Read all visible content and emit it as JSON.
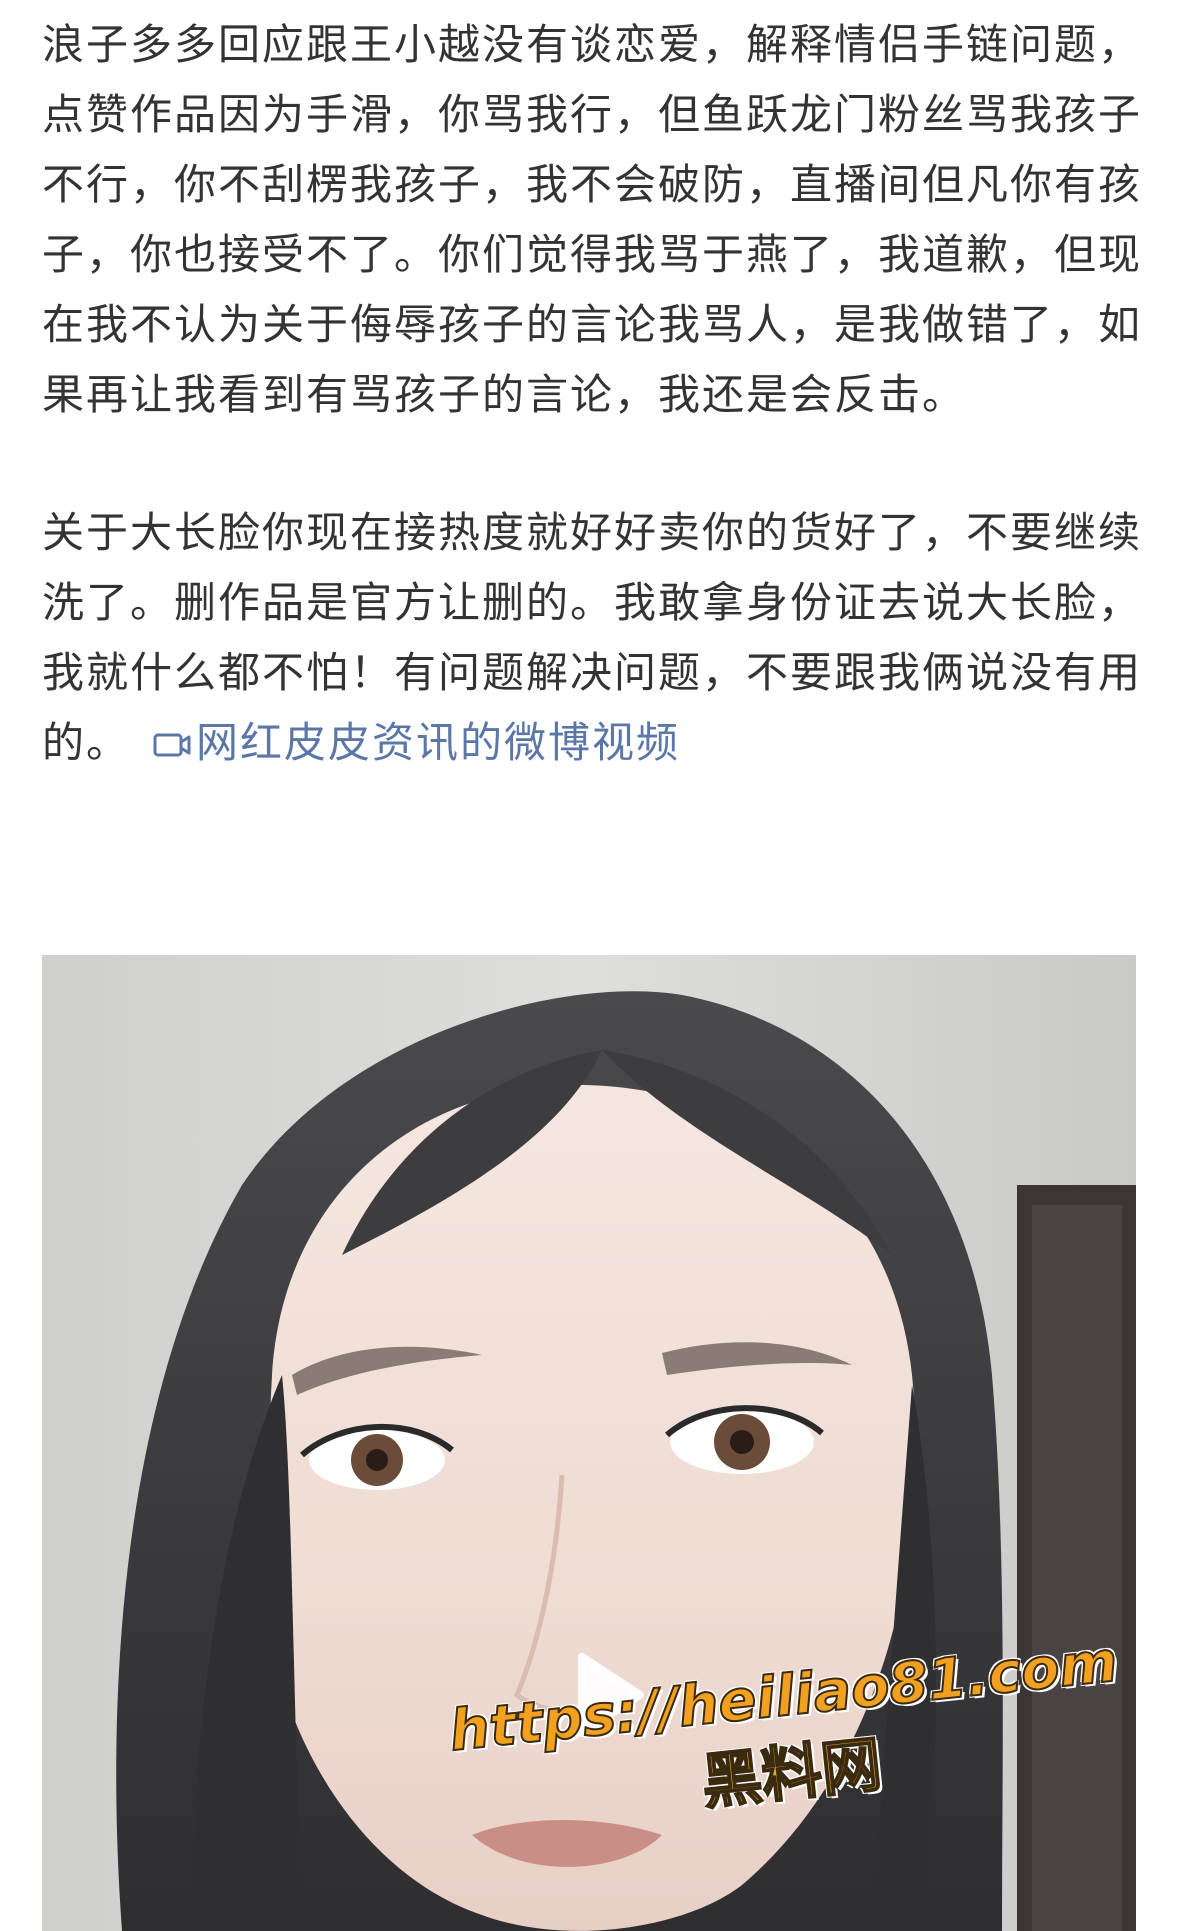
{
  "post": {
    "paragraph_1": "浪子多多回应跟王小越没有谈恋爱，解释情侣手链问题，点赞作品因为手滑，你骂我行，但鱼跃龙门粉丝骂我孩子不行，你不刮楞我孩子，我不会破防，直播间但凡你有孩子，你也接受不了。你们觉得我骂于燕了，我道歉，但现在我不认为关于侮辱孩子的言论我骂人，是我做错了，如果再让我看到有骂孩子的言论，我还是会反击。",
    "paragraph_2": "关于大长脸你现在接热度就好好卖你的货好了，不要继续洗了。删作品是官方让删的。我敢拿身份证去说大长脸，我就什么都不怕！有问题解决问题，不要跟我俩说没有用的。",
    "video_link_label": "网红皮皮资讯的微博视频",
    "video_link_icon": "video-camera-icon",
    "link_color": "#5b77a8"
  },
  "video": {
    "play_icon": "play-icon",
    "watermark_url": "https://heiliao81.com",
    "watermark_name": "黑料网",
    "watermark_color": "#f2a020"
  }
}
